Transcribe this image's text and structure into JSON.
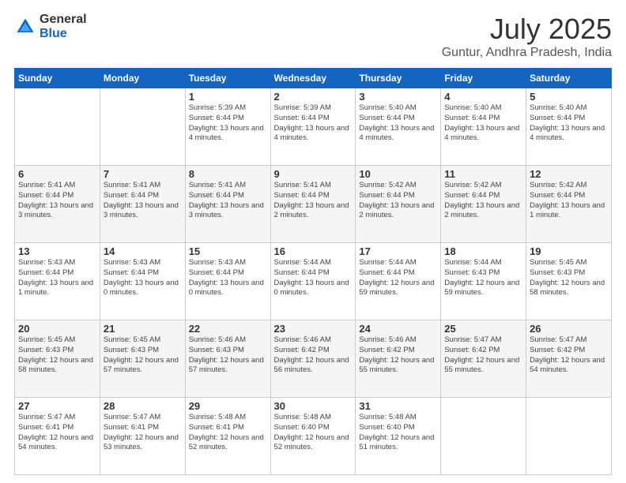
{
  "logo": {
    "general": "General",
    "blue": "Blue"
  },
  "title": "July 2025",
  "subtitle": "Guntur, Andhra Pradesh, India",
  "weekdays": [
    "Sunday",
    "Monday",
    "Tuesday",
    "Wednesday",
    "Thursday",
    "Friday",
    "Saturday"
  ],
  "weeks": [
    [
      {
        "day": "",
        "sunrise": "",
        "sunset": "",
        "daylight": ""
      },
      {
        "day": "",
        "sunrise": "",
        "sunset": "",
        "daylight": ""
      },
      {
        "day": "1",
        "sunrise": "Sunrise: 5:39 AM",
        "sunset": "Sunset: 6:44 PM",
        "daylight": "Daylight: 13 hours and 4 minutes."
      },
      {
        "day": "2",
        "sunrise": "Sunrise: 5:39 AM",
        "sunset": "Sunset: 6:44 PM",
        "daylight": "Daylight: 13 hours and 4 minutes."
      },
      {
        "day": "3",
        "sunrise": "Sunrise: 5:40 AM",
        "sunset": "Sunset: 6:44 PM",
        "daylight": "Daylight: 13 hours and 4 minutes."
      },
      {
        "day": "4",
        "sunrise": "Sunrise: 5:40 AM",
        "sunset": "Sunset: 6:44 PM",
        "daylight": "Daylight: 13 hours and 4 minutes."
      },
      {
        "day": "5",
        "sunrise": "Sunrise: 5:40 AM",
        "sunset": "Sunset: 6:44 PM",
        "daylight": "Daylight: 13 hours and 4 minutes."
      }
    ],
    [
      {
        "day": "6",
        "sunrise": "Sunrise: 5:41 AM",
        "sunset": "Sunset: 6:44 PM",
        "daylight": "Daylight: 13 hours and 3 minutes."
      },
      {
        "day": "7",
        "sunrise": "Sunrise: 5:41 AM",
        "sunset": "Sunset: 6:44 PM",
        "daylight": "Daylight: 13 hours and 3 minutes."
      },
      {
        "day": "8",
        "sunrise": "Sunrise: 5:41 AM",
        "sunset": "Sunset: 6:44 PM",
        "daylight": "Daylight: 13 hours and 3 minutes."
      },
      {
        "day": "9",
        "sunrise": "Sunrise: 5:41 AM",
        "sunset": "Sunset: 6:44 PM",
        "daylight": "Daylight: 13 hours and 2 minutes."
      },
      {
        "day": "10",
        "sunrise": "Sunrise: 5:42 AM",
        "sunset": "Sunset: 6:44 PM",
        "daylight": "Daylight: 13 hours and 2 minutes."
      },
      {
        "day": "11",
        "sunrise": "Sunrise: 5:42 AM",
        "sunset": "Sunset: 6:44 PM",
        "daylight": "Daylight: 13 hours and 2 minutes."
      },
      {
        "day": "12",
        "sunrise": "Sunrise: 5:42 AM",
        "sunset": "Sunset: 6:44 PM",
        "daylight": "Daylight: 13 hours and 1 minute."
      }
    ],
    [
      {
        "day": "13",
        "sunrise": "Sunrise: 5:43 AM",
        "sunset": "Sunset: 6:44 PM",
        "daylight": "Daylight: 13 hours and 1 minute."
      },
      {
        "day": "14",
        "sunrise": "Sunrise: 5:43 AM",
        "sunset": "Sunset: 6:44 PM",
        "daylight": "Daylight: 13 hours and 0 minutes."
      },
      {
        "day": "15",
        "sunrise": "Sunrise: 5:43 AM",
        "sunset": "Sunset: 6:44 PM",
        "daylight": "Daylight: 13 hours and 0 minutes."
      },
      {
        "day": "16",
        "sunrise": "Sunrise: 5:44 AM",
        "sunset": "Sunset: 6:44 PM",
        "daylight": "Daylight: 13 hours and 0 minutes."
      },
      {
        "day": "17",
        "sunrise": "Sunrise: 5:44 AM",
        "sunset": "Sunset: 6:44 PM",
        "daylight": "Daylight: 12 hours and 59 minutes."
      },
      {
        "day": "18",
        "sunrise": "Sunrise: 5:44 AM",
        "sunset": "Sunset: 6:43 PM",
        "daylight": "Daylight: 12 hours and 59 minutes."
      },
      {
        "day": "19",
        "sunrise": "Sunrise: 5:45 AM",
        "sunset": "Sunset: 6:43 PM",
        "daylight": "Daylight: 12 hours and 58 minutes."
      }
    ],
    [
      {
        "day": "20",
        "sunrise": "Sunrise: 5:45 AM",
        "sunset": "Sunset: 6:43 PM",
        "daylight": "Daylight: 12 hours and 58 minutes."
      },
      {
        "day": "21",
        "sunrise": "Sunrise: 5:45 AM",
        "sunset": "Sunset: 6:43 PM",
        "daylight": "Daylight: 12 hours and 57 minutes."
      },
      {
        "day": "22",
        "sunrise": "Sunrise: 5:46 AM",
        "sunset": "Sunset: 6:43 PM",
        "daylight": "Daylight: 12 hours and 57 minutes."
      },
      {
        "day": "23",
        "sunrise": "Sunrise: 5:46 AM",
        "sunset": "Sunset: 6:42 PM",
        "daylight": "Daylight: 12 hours and 56 minutes."
      },
      {
        "day": "24",
        "sunrise": "Sunrise: 5:46 AM",
        "sunset": "Sunset: 6:42 PM",
        "daylight": "Daylight: 12 hours and 55 minutes."
      },
      {
        "day": "25",
        "sunrise": "Sunrise: 5:47 AM",
        "sunset": "Sunset: 6:42 PM",
        "daylight": "Daylight: 12 hours and 55 minutes."
      },
      {
        "day": "26",
        "sunrise": "Sunrise: 5:47 AM",
        "sunset": "Sunset: 6:42 PM",
        "daylight": "Daylight: 12 hours and 54 minutes."
      }
    ],
    [
      {
        "day": "27",
        "sunrise": "Sunrise: 5:47 AM",
        "sunset": "Sunset: 6:41 PM",
        "daylight": "Daylight: 12 hours and 54 minutes."
      },
      {
        "day": "28",
        "sunrise": "Sunrise: 5:47 AM",
        "sunset": "Sunset: 6:41 PM",
        "daylight": "Daylight: 12 hours and 53 minutes."
      },
      {
        "day": "29",
        "sunrise": "Sunrise: 5:48 AM",
        "sunset": "Sunset: 6:41 PM",
        "daylight": "Daylight: 12 hours and 52 minutes."
      },
      {
        "day": "30",
        "sunrise": "Sunrise: 5:48 AM",
        "sunset": "Sunset: 6:40 PM",
        "daylight": "Daylight: 12 hours and 52 minutes."
      },
      {
        "day": "31",
        "sunrise": "Sunrise: 5:48 AM",
        "sunset": "Sunset: 6:40 PM",
        "daylight": "Daylight: 12 hours and 51 minutes."
      },
      {
        "day": "",
        "sunrise": "",
        "sunset": "",
        "daylight": ""
      },
      {
        "day": "",
        "sunrise": "",
        "sunset": "",
        "daylight": ""
      }
    ]
  ]
}
